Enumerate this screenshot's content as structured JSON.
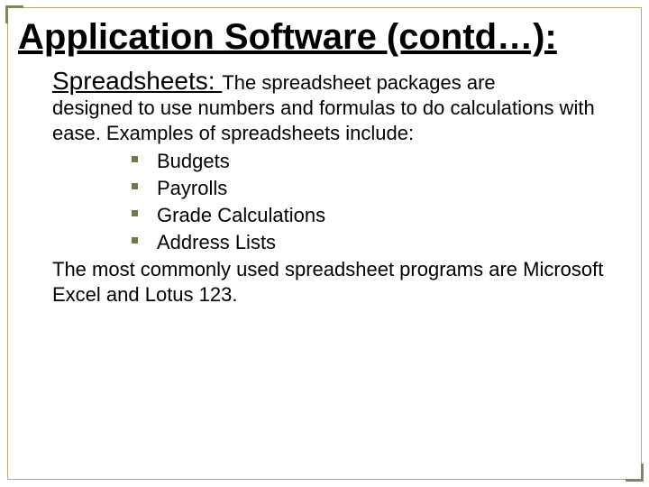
{
  "title": "Application Software  (contd…):",
  "subheading": "Spreadsheets: ",
  "intro_inline": "The spreadsheet packages are",
  "intro_rest": "designed to use numbers and formulas to do calculations with ease. Examples of spreadsheets include:",
  "examples": [
    "Budgets",
    "Payrolls",
    "Grade Calculations",
    "Address Lists"
  ],
  "closing": "The most commonly used spreadsheet programs are Microsoft Excel and Lotus 123.",
  "colors": {
    "frame_border": "#b8a878",
    "accent_corner": "#7a8a5a",
    "bullet": "#6b7a4a"
  }
}
